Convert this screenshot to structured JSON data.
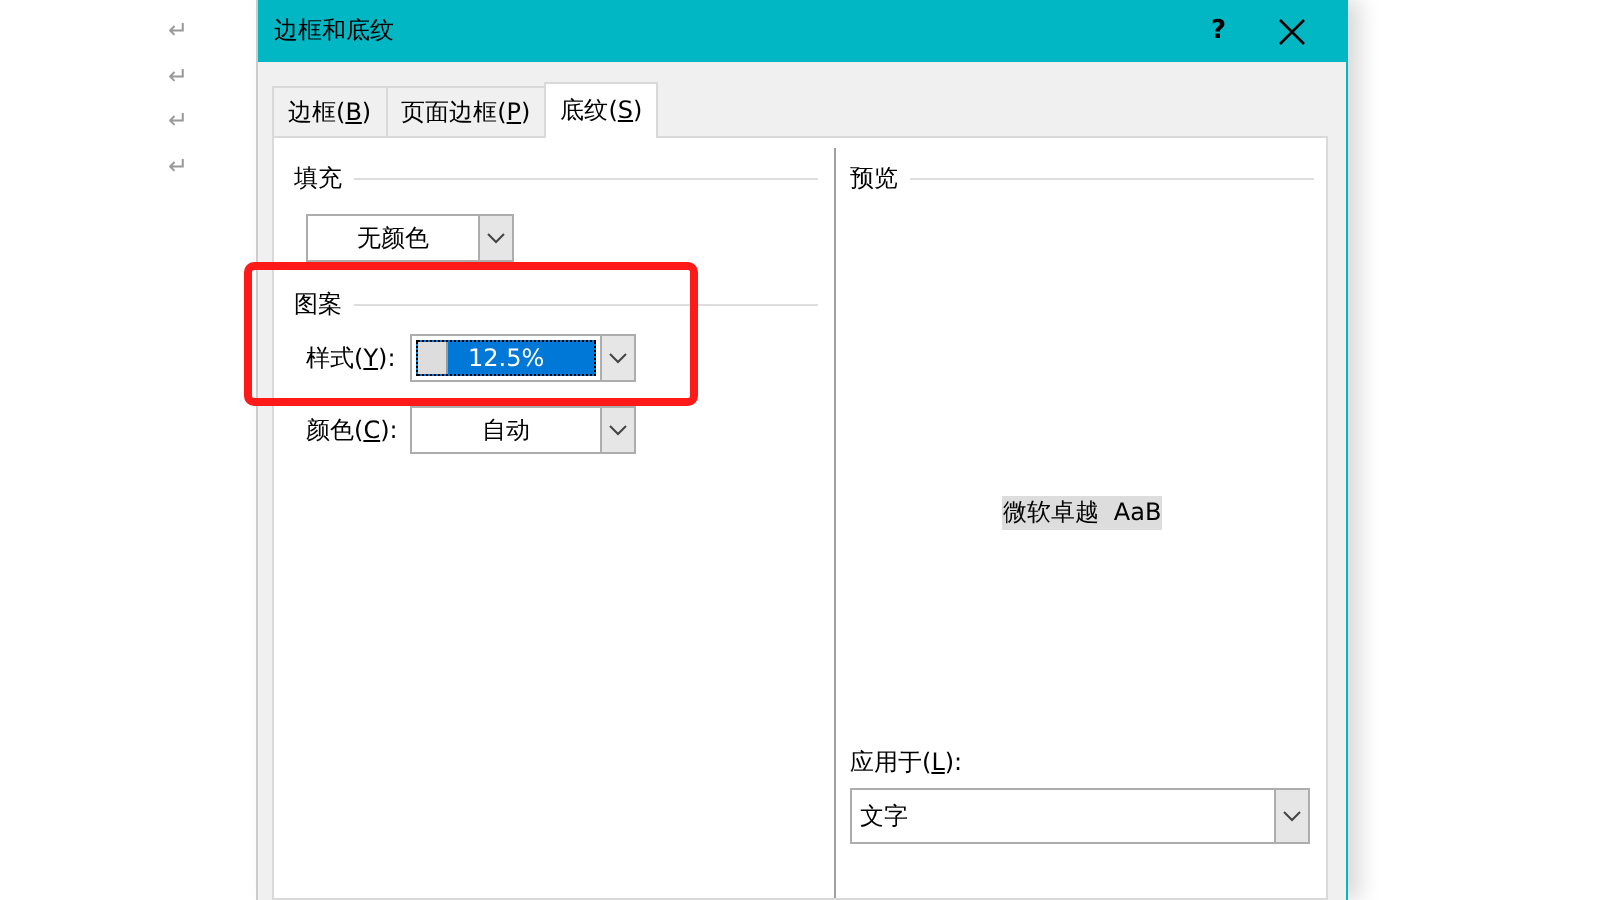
{
  "document": {
    "paragraph_marks": [
      "↵",
      "↵",
      "↵",
      "↵"
    ]
  },
  "window": {
    "title": "边框和底纹",
    "help": "?"
  },
  "tabs": [
    {
      "pre": "边框(",
      "key": "B",
      "post": ")",
      "selected": false
    },
    {
      "pre": "页面边框(",
      "key": "P",
      "post": ")",
      "selected": false
    },
    {
      "pre": "底纹(",
      "key": "S",
      "post": ")",
      "selected": true
    }
  ],
  "fill": {
    "heading": "填充",
    "value": "无颜色"
  },
  "pattern": {
    "heading": "图案",
    "highlighted": true,
    "style": {
      "pre": "样式(",
      "key": "Y",
      "post": "):",
      "value": "12.5%"
    },
    "color": {
      "pre": "颜色(",
      "key": "C",
      "post": "):",
      "value": "自动"
    }
  },
  "preview": {
    "heading": "预览",
    "sample": "微软卓越  AaB"
  },
  "apply_to": {
    "pre": "应用于(",
    "key": "L",
    "post": "):",
    "value": "文字"
  }
}
